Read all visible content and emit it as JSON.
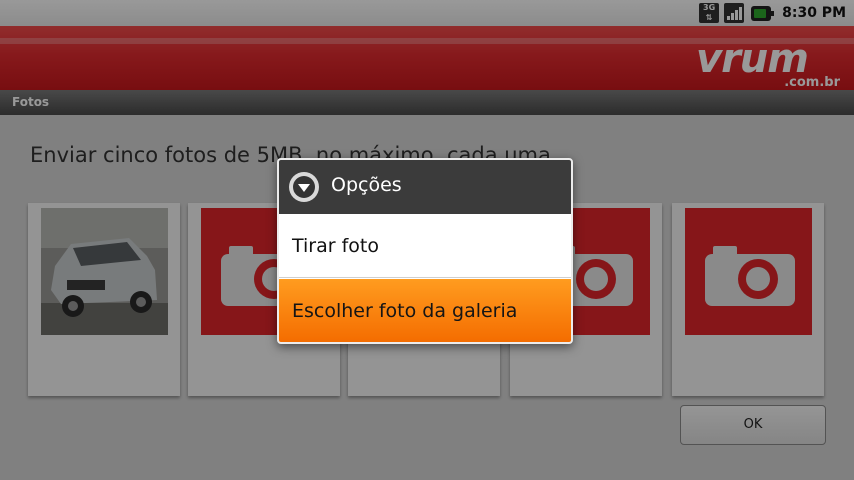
{
  "status_bar": {
    "network_label": "3G",
    "time": "8:30 PM",
    "icons": [
      "3g-icon",
      "signal-icon",
      "battery-icon"
    ]
  },
  "banner": {
    "logo_text": "vrum",
    "logo_suffix": ".com.br",
    "color": "#e12b2f"
  },
  "title_bar": {
    "title": "Fotos"
  },
  "content": {
    "instruction": "Enviar cinco fotos de 5MB, no máximo, cada uma.",
    "slots": [
      {
        "type": "photo",
        "icon": "car-photo"
      },
      {
        "type": "empty",
        "icon": "camera-icon"
      },
      {
        "type": "empty",
        "icon": "camera-icon"
      },
      {
        "type": "empty",
        "icon": "camera-icon"
      },
      {
        "type": "empty",
        "icon": "camera-icon"
      }
    ],
    "ok_label": "OK"
  },
  "dialog": {
    "title": "Opções",
    "items": [
      {
        "label": "Tirar foto",
        "selected": false
      },
      {
        "label": "Escolher foto da galeria",
        "selected": true
      }
    ],
    "highlight_color": "#f57a06"
  }
}
